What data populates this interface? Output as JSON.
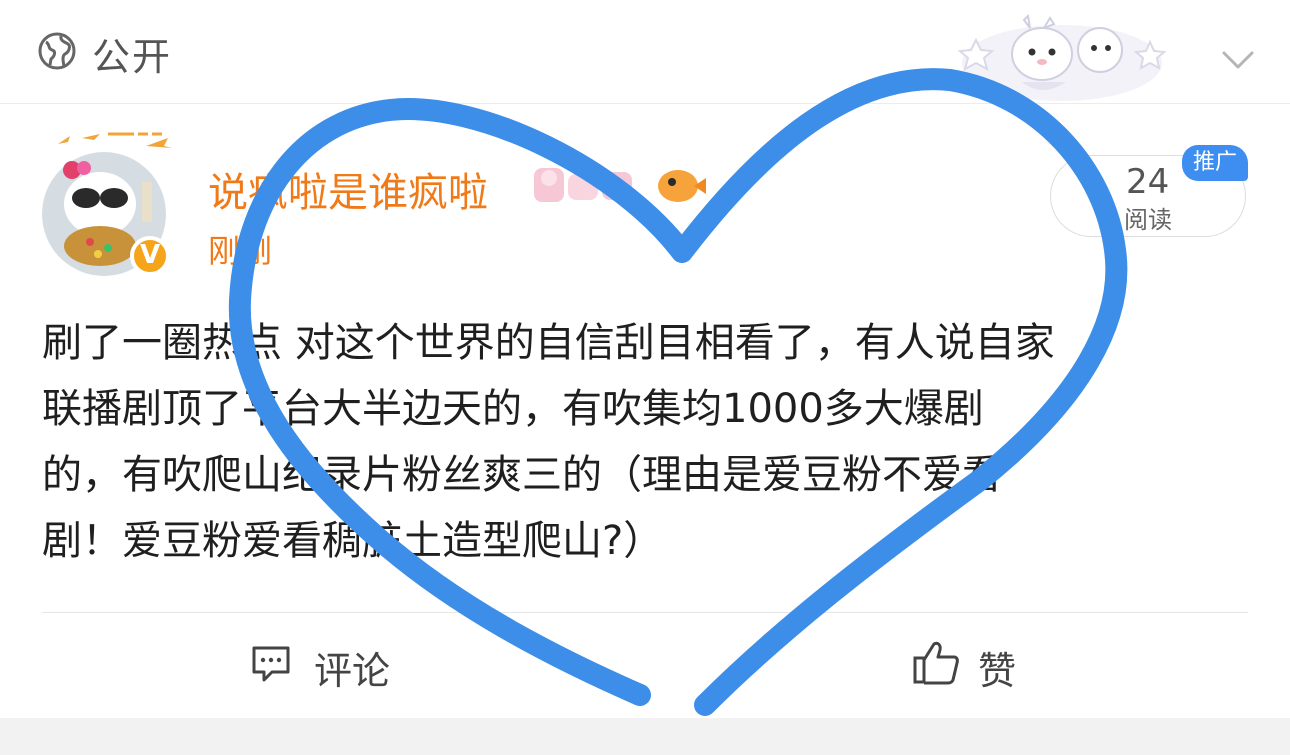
{
  "header": {
    "visibility_icon": "globe-icon",
    "visibility_label": "公开",
    "expand_icon": "chevron-down-icon"
  },
  "post": {
    "author": "说疯啦是谁疯啦",
    "verified_badge": "V",
    "timestamp": "刚刚",
    "read_count": "24",
    "read_label": "阅读",
    "promote_badge": "推广",
    "text_lines": [
      "刷了一圈热点 对这个世界的自信刮目相看了，有人说自家",
      "联播剧顶了平台大半边天的，有吹集均1000多大爆剧",
      "的，有吹爬山纪录片粉丝爽三的（理由是爱豆粉不爱看",
      "剧！爱豆粉爱看稠脏土造型爬山?）"
    ]
  },
  "actions": {
    "comment_label": "评论",
    "comment_icon": "comment-icon",
    "like_label": "赞",
    "like_icon": "thumbs-up-icon"
  },
  "overlay": {
    "heart_color": "#3d8ee8"
  },
  "colors": {
    "username": "#f07a18",
    "badge_blue": "#3d8ef0",
    "verified_bg": "#f6a41a"
  }
}
